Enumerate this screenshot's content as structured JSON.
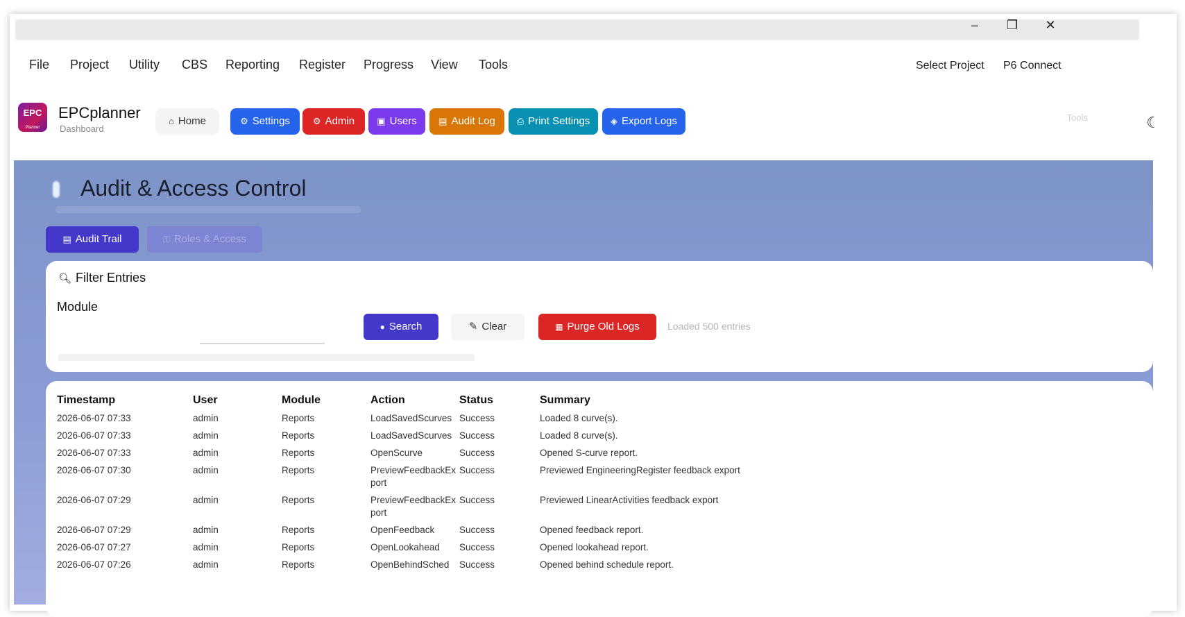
{
  "window": {
    "minimize": "–",
    "restore": "❐",
    "close": "✕"
  },
  "menu": {
    "items": [
      "File",
      "Project",
      "Utility",
      "CBS",
      "Reporting",
      "Register",
      "Progress",
      "View",
      "Tools"
    ],
    "right": [
      "Select Project",
      "P6 Connect"
    ]
  },
  "app": {
    "logo_text": "EPC",
    "logo_sub": "Planner",
    "name": "EPCplanner",
    "subtitle": "Dashboard",
    "nav": [
      {
        "label": "Home",
        "icon": "home-icon",
        "color": "#f3f4f6"
      },
      {
        "label": "Settings",
        "icon": "gear-icon",
        "color": "#2563eb"
      },
      {
        "label": "Admin",
        "icon": "gear-icon",
        "color": "#dc2626"
      },
      {
        "label": "Users",
        "icon": "users-icon",
        "color": "#7c3aed"
      },
      {
        "label": "Audit Log",
        "icon": "clipboard-icon",
        "color": "#d97706"
      },
      {
        "label": "Print Settings",
        "icon": "printer-icon",
        "color": "#0891b2"
      },
      {
        "label": "Export Logs",
        "icon": "box-icon",
        "color": "#2563eb"
      }
    ],
    "faint_right": "Tools"
  },
  "page": {
    "title": "Audit & Access Control",
    "tabs": [
      "Audit Trail",
      "Roles & Access"
    ]
  },
  "filter": {
    "title": "Filter Entries",
    "module_label": "Module",
    "search_label": "Search",
    "clear_label": "Clear",
    "purge_label": "Purge Old Logs",
    "loaded_text": "Loaded 500 entries"
  },
  "table": {
    "headers": [
      "Timestamp",
      "User",
      "Module",
      "Action",
      "Status",
      "Summary"
    ],
    "rows": [
      [
        "2026-06-07 07:33",
        "admin",
        "Reports",
        "LoadSavedScurves",
        "Success",
        "Loaded 8 curve(s)."
      ],
      [
        "2026-06-07 07:33",
        "admin",
        "Reports",
        "LoadSavedScurves",
        "Success",
        "Loaded 8 curve(s)."
      ],
      [
        "2026-06-07 07:33",
        "admin",
        "Reports",
        "OpenScurve",
        "Success",
        "Opened S-curve report."
      ],
      [
        "2026-06-07 07:30",
        "admin",
        "Reports",
        "PreviewFeedbackExport",
        "Success",
        "Previewed EngineeringRegister feedback export"
      ],
      [
        "2026-06-07 07:29",
        "admin",
        "Reports",
        "PreviewFeedbackExport",
        "Success",
        "Previewed LinearActivities feedback export"
      ],
      [
        "2026-06-07 07:29",
        "admin",
        "Reports",
        "OpenFeedback",
        "Success",
        "Opened feedback report."
      ],
      [
        "2026-06-07 07:27",
        "admin",
        "Reports",
        "OpenLookahead",
        "Success",
        "Opened lookahead report."
      ],
      [
        "2026-06-07 07:26",
        "admin",
        "Reports",
        "OpenBehindSched",
        "Success",
        "Opened behind schedule report."
      ]
    ]
  }
}
